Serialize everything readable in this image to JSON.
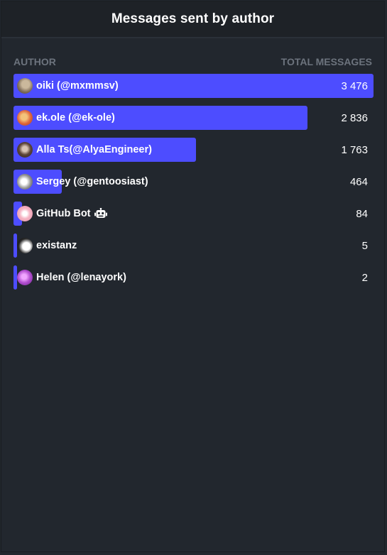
{
  "header": {
    "title": "Messages sent by author"
  },
  "columns": {
    "author": "AUTHOR",
    "total": "TOTAL MESSAGES"
  },
  "chart_data": {
    "type": "bar",
    "orientation": "horizontal",
    "title": "Messages sent by author",
    "xlabel": "TOTAL MESSAGES",
    "ylabel": "AUTHOR",
    "categories": [
      "oiki (@mxmmsv)",
      "ek.ole (@ek-ole)",
      "Alla Ts(@AlyaEngineer)",
      "Sergey (@gentoosiast)",
      "GitHub Bot",
      "existanz",
      "Helen (@lenayork)"
    ],
    "values": [
      3476,
      2836,
      1763,
      464,
      84,
      5,
      2
    ],
    "value_labels": [
      "3 476",
      "2 836",
      "1 763",
      "464",
      "84",
      "5",
      "2"
    ],
    "bar_color": "#4d4dff",
    "xlim": [
      0,
      3476
    ],
    "grid": false,
    "legend": "none"
  },
  "rows": [
    {
      "name": "oiki (@mxmmsv)",
      "value_label": "3 476",
      "avatar": "avatar-oiki",
      "icon": ""
    },
    {
      "name": "ek.ole (@ek-ole)",
      "value_label": "2 836",
      "avatar": "avatar-ek-ole",
      "icon": ""
    },
    {
      "name": "Alla Ts(@AlyaEngineer)",
      "value_label": "1 763",
      "avatar": "avatar-alla",
      "icon": ""
    },
    {
      "name": "Sergey (@gentoosiast)",
      "value_label": "464",
      "avatar": "avatar-sergey",
      "icon": ""
    },
    {
      "name": "GitHub Bot",
      "value_label": "84",
      "avatar": "avatar-github-bot",
      "icon": "robot-icon"
    },
    {
      "name": "existanz",
      "value_label": "5",
      "avatar": "avatar-existanz",
      "icon": ""
    },
    {
      "name": "Helen (@lenayork)",
      "value_label": "2",
      "avatar": "avatar-helen",
      "icon": ""
    }
  ],
  "colors": {
    "background": "#22272e",
    "header_background": "#1e2227",
    "bar": "#4d4dff",
    "column_header_text": "#6c737d",
    "text": "#ffffff"
  }
}
